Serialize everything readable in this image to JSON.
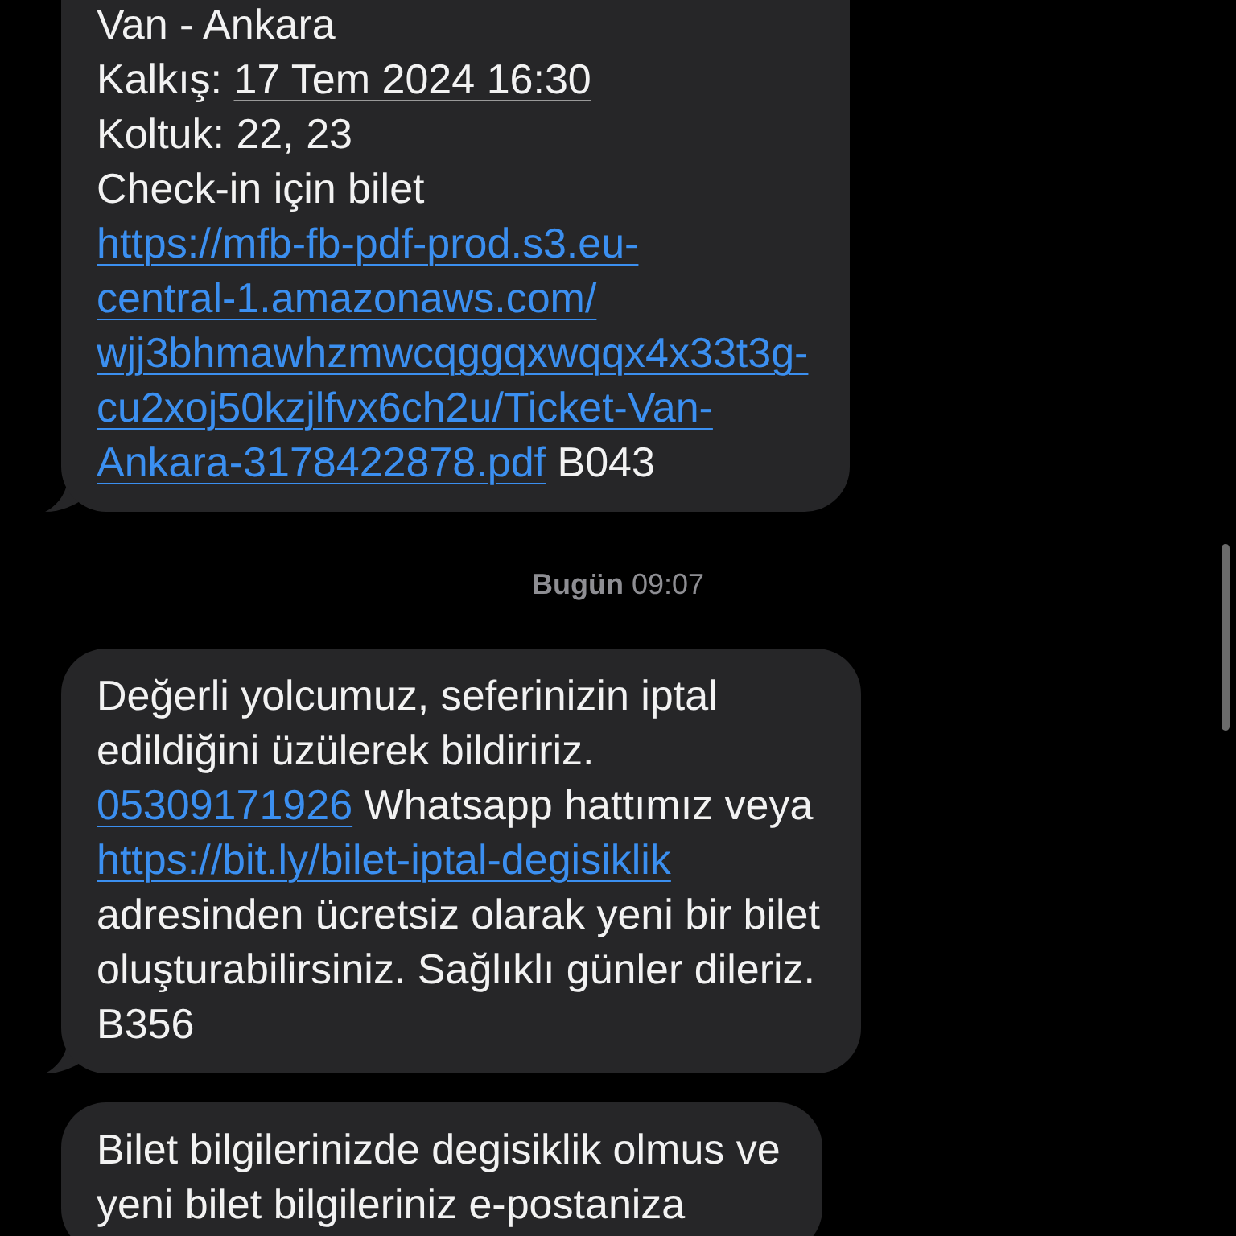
{
  "conversation": [
    {
      "kind": "message",
      "tail": true,
      "lines": [
        [
          {
            "kind": "text",
            "text": "Van - Ankara"
          }
        ],
        [
          {
            "kind": "text",
            "text": "Kalkış: "
          },
          {
            "kind": "date",
            "text": "17 Tem 2024 16:30"
          }
        ],
        [
          {
            "kind": "text",
            "text": "Koltuk: 22, 23"
          }
        ],
        [
          {
            "kind": "text",
            "text": "Check-in için bilet"
          }
        ],
        [
          {
            "kind": "link",
            "text": "https://mfb-fb-pdf-prod.s3.eu-"
          }
        ],
        [
          {
            "kind": "link",
            "text": "central-1.amazonaws.com/"
          }
        ],
        [
          {
            "kind": "link",
            "text": "wjj3bhmawhzmwcqggqxwqqx4x33t3g-"
          }
        ],
        [
          {
            "kind": "link",
            "text": "cu2xoj50kzjlfvx6ch2u/Ticket-Van-"
          }
        ],
        [
          {
            "kind": "link",
            "text": "Ankara-3178422878.pdf"
          },
          {
            "kind": "text",
            "text": " B043"
          }
        ]
      ]
    },
    {
      "kind": "timestamp",
      "day": "Bugün",
      "time": "09:07"
    },
    {
      "kind": "message",
      "tail": true,
      "lines": [
        [
          {
            "kind": "text",
            "text": "Değerli yolcumuz, seferinizin iptal"
          }
        ],
        [
          {
            "kind": "text",
            "text": "edildiğini üzülerek bildiririz."
          }
        ],
        [
          {
            "kind": "phone",
            "text": "05309171926"
          },
          {
            "kind": "text",
            "text": " Whatsapp hattımız veya"
          }
        ],
        [
          {
            "kind": "link",
            "text": "https://bit.ly/bilet-iptal-degisiklik"
          }
        ],
        [
          {
            "kind": "text",
            "text": "adresinden ücretsiz olarak yeni bir bilet"
          }
        ],
        [
          {
            "kind": "text",
            "text": "oluşturabilirsiniz. Sağlıklı günler dileriz."
          }
        ],
        [
          {
            "kind": "text",
            "text": "B356"
          }
        ]
      ]
    },
    {
      "kind": "message",
      "tail": false,
      "lines": [
        [
          {
            "kind": "text",
            "text": "Bilet bilgilerinizde degisiklik olmus ve"
          }
        ],
        [
          {
            "kind": "text",
            "text": "yeni bilet bilgileriniz e-postaniza"
          }
        ]
      ]
    }
  ]
}
